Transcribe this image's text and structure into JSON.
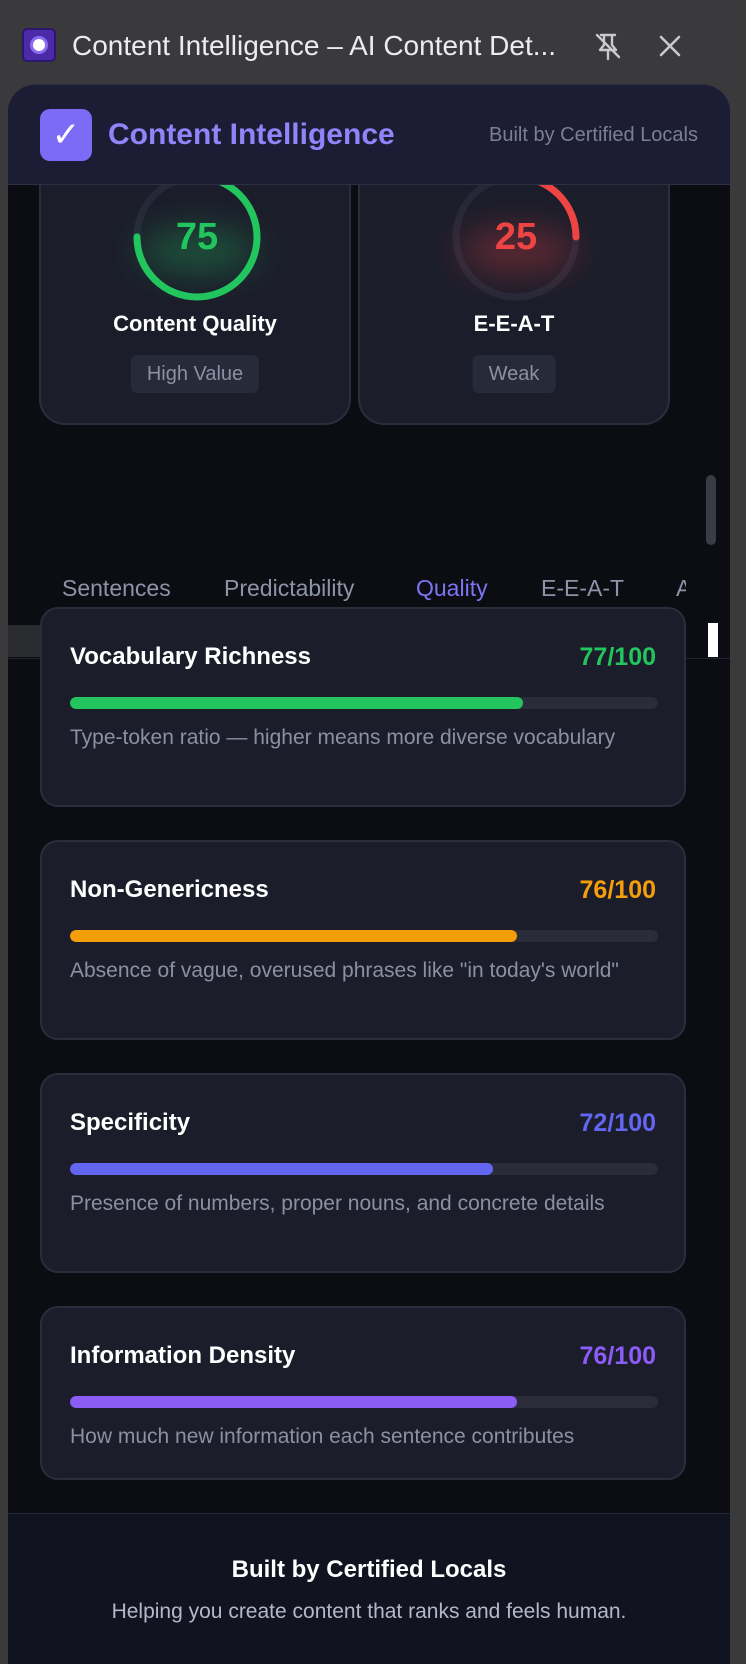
{
  "window": {
    "title": "Content Intelligence – AI Content Det..."
  },
  "header": {
    "brand": "Content Intelligence",
    "built_by": "Built by Certified Locals",
    "logo_glyph": "✓"
  },
  "scores": [
    {
      "value": "75",
      "label": "Content Quality",
      "badge": "High Value",
      "fraction": 0.75,
      "color": "#22c55e"
    },
    {
      "value": "25",
      "label": "E-E-A-T",
      "badge": "Weak",
      "fraction": 0.25,
      "color": "#ef4444"
    }
  ],
  "tabs": [
    {
      "label": "Sentences"
    },
    {
      "label": "Predictability"
    },
    {
      "label": "Quality",
      "active": true
    },
    {
      "label": "E-E-A-T"
    },
    {
      "label": "A"
    }
  ],
  "metrics": [
    {
      "title": "Vocabulary Richness",
      "score": "77/100",
      "fraction": 0.77,
      "color": "#22c55e",
      "desc": "Type-token ratio — higher means more diverse vocabulary"
    },
    {
      "title": "Non-Genericness",
      "score": "76/100",
      "fraction": 0.76,
      "color": "#f59e0b",
      "desc": "Absence of vague, overused phrases like \"in today's world\""
    },
    {
      "title": "Specificity",
      "score": "72/100",
      "fraction": 0.72,
      "color": "#6366f1",
      "desc": "Presence of numbers, proper nouns, and concrete details"
    },
    {
      "title": "Information Density",
      "score": "76/100",
      "fraction": 0.76,
      "color": "#8b5cf6",
      "desc": "How much new information each sentence contributes"
    }
  ],
  "footer": {
    "title": "Built by Certified Locals",
    "subtitle": "Helping you create content that ranks and feels human."
  },
  "icons": {
    "pin": "unpin-icon",
    "close": "close-icon"
  }
}
